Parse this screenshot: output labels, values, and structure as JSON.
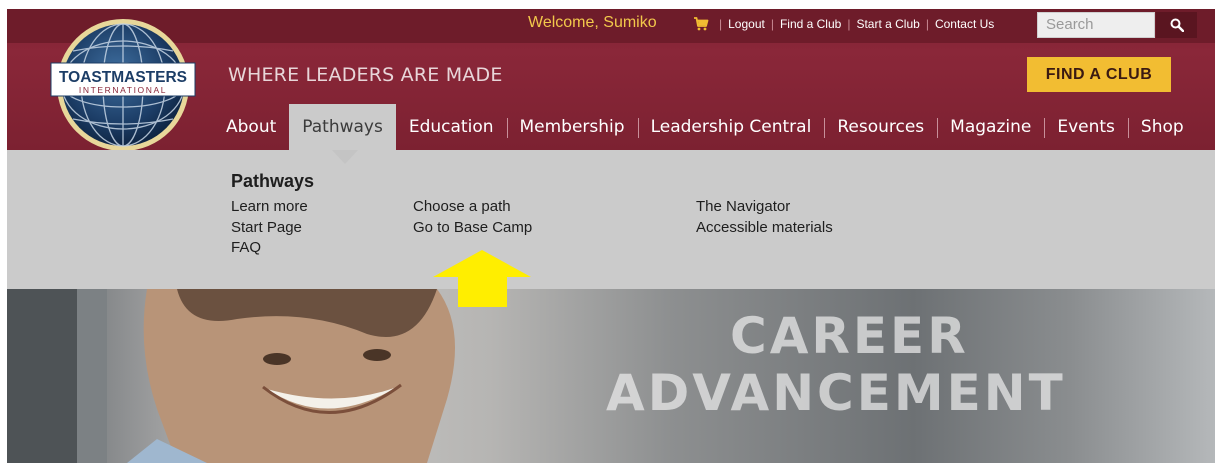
{
  "header": {
    "welcome_text": "Welcome, Sumiko",
    "utility_links": [
      "Logout",
      "Find a Club",
      "Start a Club",
      "Contact Us"
    ],
    "search_placeholder": "Search",
    "tagline": "WHERE LEADERS ARE MADE",
    "find_club_label": "FIND A CLUB",
    "logo_text_main": "TOASTMASTERS",
    "logo_text_sub": "INTERNATIONAL"
  },
  "nav": {
    "items": [
      "About",
      "Pathways",
      "Education",
      "Membership",
      "Leadership Central",
      "Resources",
      "Magazine",
      "Events",
      "Shop"
    ],
    "active": "Pathways"
  },
  "dropdown": {
    "heading": "Pathways",
    "col1": [
      "Learn more",
      "Start Page",
      "FAQ"
    ],
    "col2": [
      "Choose a path",
      "Go to Base Camp"
    ],
    "col3": [
      "The Navigator",
      "Accessible materials"
    ]
  },
  "hero": {
    "line1": "CAREER",
    "line2": "ADVANCEMENT"
  },
  "colors": {
    "header_bg": "#7e2232",
    "topbar_bg": "#6e1c2a",
    "accent_gold": "#f2bd32",
    "welcome_gold": "#f2c84b",
    "dropdown_bg": "#cbcbcb",
    "arrow_yellow": "#ffee00"
  },
  "icons": {
    "cart": "cart-icon",
    "search": "search-icon",
    "logo": "toastmasters-globe-logo",
    "arrow": "up-arrow-annotation-icon"
  }
}
